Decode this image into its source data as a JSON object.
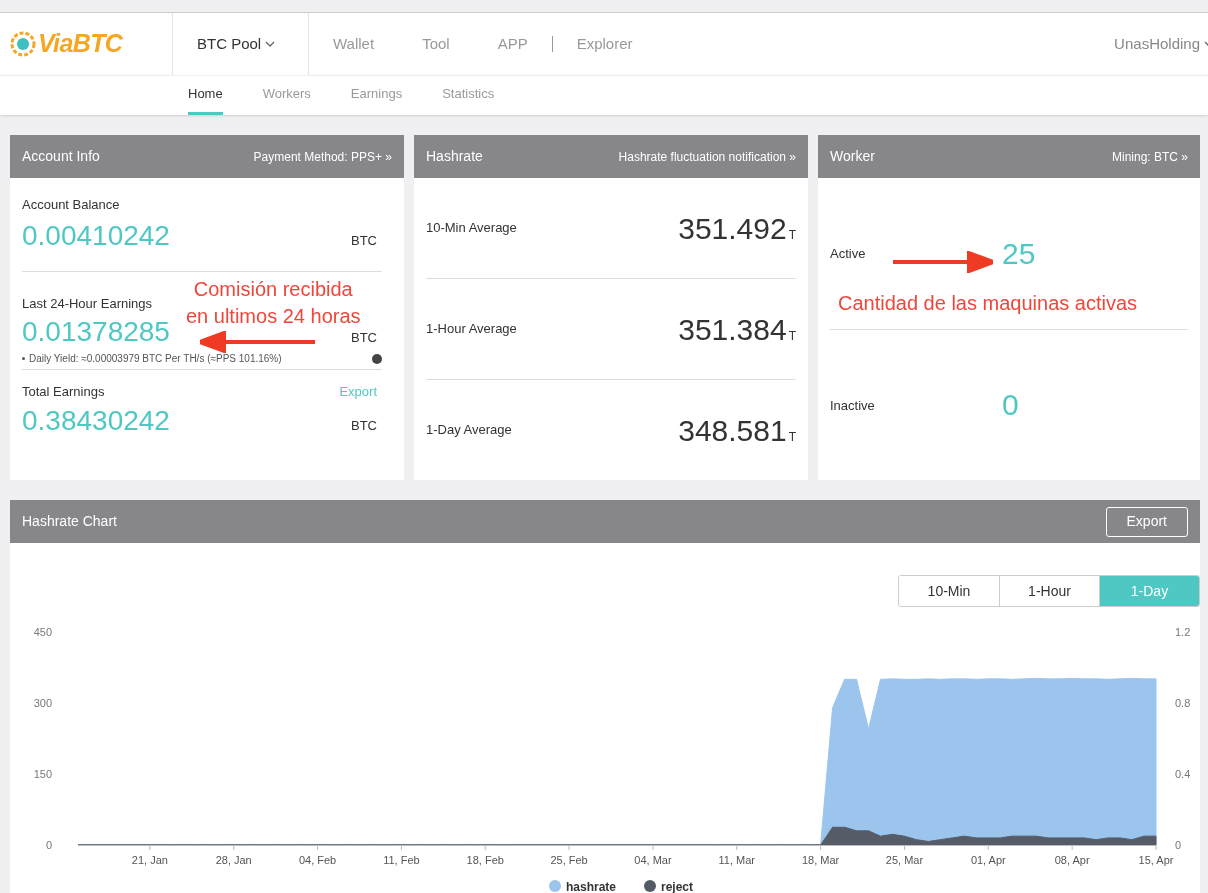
{
  "header": {
    "logo": "ViaBTC",
    "nav": [
      {
        "label": "BTC Pool",
        "selected": true,
        "dropdown": true
      },
      {
        "label": "Wallet",
        "selected": false,
        "dropdown": false
      },
      {
        "label": "Tool",
        "selected": false,
        "dropdown": false
      },
      {
        "label": "APP",
        "selected": false,
        "dropdown": false
      },
      {
        "label": "Explorer",
        "selected": false,
        "dropdown": false
      }
    ],
    "user": "UnasHolding"
  },
  "subnav": [
    {
      "label": "Home",
      "selected": true
    },
    {
      "label": "Workers",
      "selected": false
    },
    {
      "label": "Earnings",
      "selected": false
    },
    {
      "label": "Statistics",
      "selected": false
    }
  ],
  "account_info": {
    "title": "Account Info",
    "link": "Payment Method: PPS+ »",
    "balance": {
      "label": "Account Balance",
      "value": "0.00410242",
      "unit": "BTC"
    },
    "last_24h": {
      "label": "Last 24-Hour Earnings",
      "value": "0.01378285",
      "unit": "BTC",
      "note": "Daily Yield: ≈0.00003979 BTC Per TH/s (≈PPS 101.16%)"
    },
    "total": {
      "label": "Total Earnings",
      "action": "Export",
      "value": "0.38430242",
      "unit": "BTC"
    }
  },
  "hashrate": {
    "title": "Hashrate",
    "link": "Hashrate fluctuation notification »",
    "rows": [
      {
        "label": "10-Min Average",
        "value": "351.492",
        "unit": "T"
      },
      {
        "label": "1-Hour Average",
        "value": "351.384",
        "unit": "T"
      },
      {
        "label": "1-Day Average",
        "value": "348.581",
        "unit": "T"
      }
    ]
  },
  "worker": {
    "title": "Worker",
    "link": "Mining: BTC »",
    "rows": [
      {
        "label": "Active",
        "value": "25"
      },
      {
        "label": "Inactive",
        "value": "0"
      }
    ]
  },
  "annotations": [
    {
      "lines": [
        "Comisión recibida",
        "en ultimos 24 horas"
      ]
    },
    {
      "lines": [
        "Cantidad de las maquinas activas"
      ]
    }
  ],
  "hashrate_chart": {
    "title": "Hashrate Chart",
    "export": "Export",
    "ranges": [
      {
        "label": "10-Min",
        "selected": false
      },
      {
        "label": "1-Hour",
        "selected": false
      },
      {
        "label": "1-Day",
        "selected": true
      }
    ],
    "chart_data": {
      "type": "area",
      "categories": [
        null,
        null,
        null,
        null,
        null,
        null,
        "21, Jan",
        null,
        null,
        null,
        null,
        null,
        null,
        "28, Jan",
        null,
        null,
        null,
        null,
        null,
        null,
        "04, Feb",
        null,
        null,
        null,
        null,
        null,
        null,
        "11, Feb",
        null,
        null,
        null,
        null,
        null,
        null,
        "18, Feb",
        null,
        null,
        null,
        null,
        null,
        null,
        "25, Feb",
        null,
        null,
        null,
        null,
        null,
        null,
        "04, Mar",
        null,
        null,
        null,
        null,
        null,
        null,
        "11, Mar",
        null,
        null,
        null,
        null,
        null,
        null,
        "18, Mar",
        null,
        null,
        null,
        null,
        null,
        null,
        "25, Mar",
        null,
        null,
        null,
        null,
        null,
        null,
        "01, Apr",
        null,
        null,
        null,
        null,
        null,
        null,
        "08, Apr",
        null,
        null,
        null,
        null,
        null,
        null,
        "15, Apr"
      ],
      "series": [
        {
          "name": "hashrate",
          "color": "#9cc5ee",
          "axis": "y",
          "values": [
            0,
            0,
            0,
            0,
            0,
            0,
            0,
            0,
            0,
            0,
            0,
            0,
            0,
            0,
            0,
            0,
            0,
            0,
            0,
            0,
            0,
            0,
            0,
            0,
            0,
            0,
            0,
            0,
            0,
            0,
            0,
            0,
            0,
            0,
            0,
            0,
            0,
            0,
            0,
            0,
            0,
            0,
            0,
            0,
            0,
            0,
            0,
            0,
            0,
            0,
            0,
            0,
            0,
            0,
            0,
            0,
            0,
            0,
            0,
            0,
            0,
            0,
            0,
            290,
            350,
            350,
            245,
            350,
            351,
            350,
            350,
            351,
            350,
            351,
            351,
            350,
            351,
            351,
            350,
            351,
            352,
            351,
            351,
            352,
            351,
            351,
            350,
            351,
            352,
            351,
            351
          ]
        },
        {
          "name": "reject",
          "color": "#555c68",
          "axis": "y2",
          "values": [
            0,
            0,
            0,
            0,
            0,
            0,
            0,
            0,
            0,
            0,
            0,
            0,
            0,
            0,
            0,
            0,
            0,
            0,
            0,
            0,
            0,
            0,
            0,
            0,
            0,
            0,
            0,
            0,
            0,
            0,
            0,
            0,
            0,
            0,
            0,
            0,
            0,
            0,
            0,
            0,
            0,
            0,
            0,
            0,
            0,
            0,
            0,
            0,
            0,
            0,
            0,
            0,
            0,
            0,
            0,
            0,
            0,
            0,
            0,
            0,
            0,
            0,
            0,
            0.1,
            0.1,
            0.08,
            0.08,
            0.05,
            0.06,
            0.05,
            0.03,
            0.02,
            0.03,
            0.04,
            0.05,
            0.04,
            0.04,
            0.04,
            0.05,
            0.05,
            0.05,
            0.04,
            0.04,
            0.04,
            0.04,
            0.03,
            0.04,
            0.04,
            0.03,
            0.05,
            0.05
          ]
        }
      ],
      "ylim": [
        0,
        450
      ],
      "yticks": [
        0,
        150,
        300,
        450
      ],
      "y2lim": [
        0,
        1.2
      ],
      "y2ticks": [
        {
          "value": 0,
          "label": "0"
        },
        {
          "value": 0.4,
          "label": "0.4"
        },
        {
          "value": 0.8,
          "label": "0.8"
        },
        {
          "value": 1.2,
          "label": "1.2"
        }
      ],
      "legend": "bottom"
    }
  }
}
